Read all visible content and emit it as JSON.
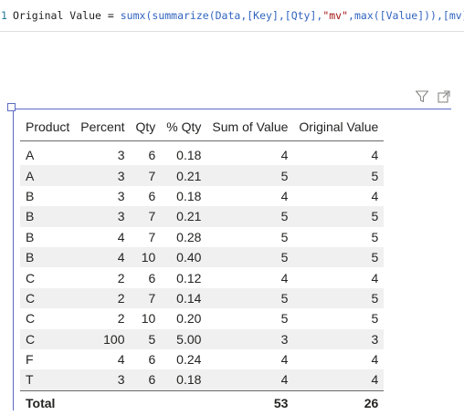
{
  "formula": {
    "line_number": "1",
    "measure_name": "Original Value",
    "operator": "=",
    "fn_sumx": "sumx",
    "open_paren_1": "(",
    "fn_summarize": "summarize",
    "args_1": "(Data,[Key],[Qty],",
    "string_mv": "\"mv\"",
    "comma": ",",
    "fn_max": "max",
    "args_2": "([Value])),[mv])"
  },
  "visual": {
    "icons": [
      "filter-icon",
      "focus-mode-icon"
    ]
  },
  "table": {
    "columns": [
      "Product",
      "Percent",
      "Qty",
      "% Qty",
      "Sum of Value",
      "Original Value"
    ],
    "rows": [
      [
        "A",
        "3",
        "6",
        "0.18",
        "4",
        "4"
      ],
      [
        "A",
        "3",
        "7",
        "0.21",
        "5",
        "5"
      ],
      [
        "B",
        "3",
        "6",
        "0.18",
        "4",
        "4"
      ],
      [
        "B",
        "3",
        "7",
        "0.21",
        "5",
        "5"
      ],
      [
        "B",
        "4",
        "7",
        "0.28",
        "5",
        "5"
      ],
      [
        "B",
        "4",
        "10",
        "0.40",
        "5",
        "5"
      ],
      [
        "C",
        "2",
        "6",
        "0.12",
        "4",
        "4"
      ],
      [
        "C",
        "2",
        "7",
        "0.14",
        "5",
        "5"
      ],
      [
        "C",
        "2",
        "10",
        "0.20",
        "5",
        "5"
      ],
      [
        "C",
        "100",
        "5",
        "5.00",
        "3",
        "3"
      ],
      [
        "F",
        "4",
        "6",
        "0.24",
        "4",
        "4"
      ],
      [
        "T",
        "3",
        "6",
        "0.18",
        "4",
        "4"
      ]
    ],
    "total": {
      "label": "Total",
      "percent": "",
      "qty": "",
      "pct_qty": "",
      "sum_of_value": "53",
      "original_value": "26"
    }
  }
}
